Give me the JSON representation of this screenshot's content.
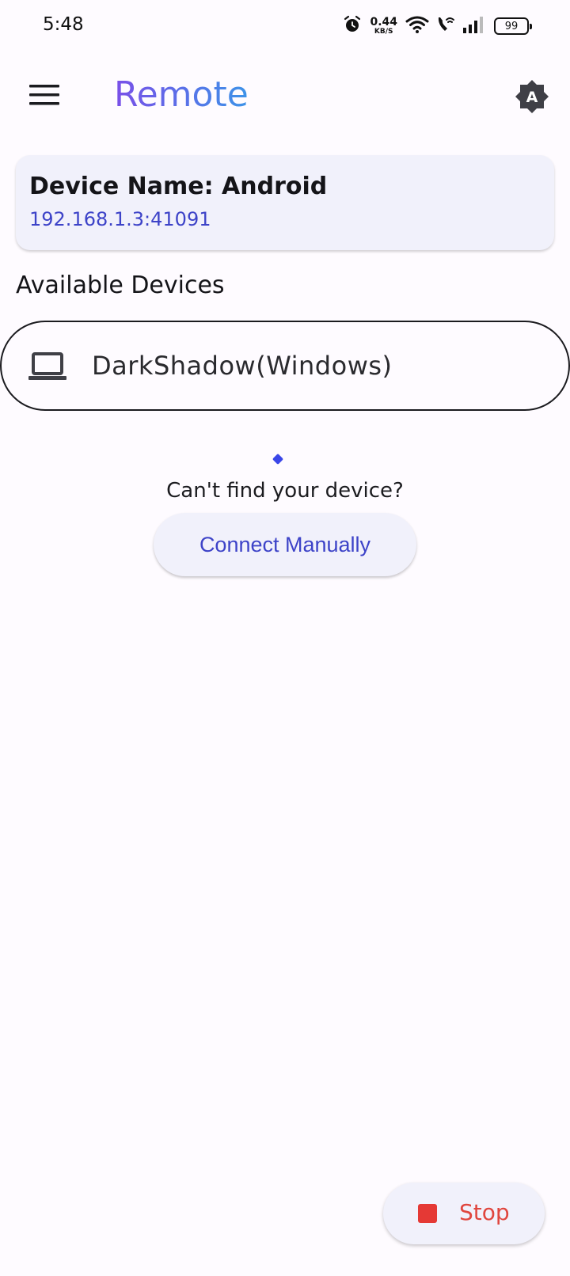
{
  "status_bar": {
    "time": "5:48",
    "net_speed_value": "0.44",
    "net_speed_unit": "KB/S",
    "battery": "99",
    "icons": [
      "alarm-icon",
      "wifi-icon",
      "wifi-calling-icon",
      "signal-icon",
      "battery-icon"
    ]
  },
  "app_bar": {
    "title": "Remote",
    "menu_icon": "menu-icon",
    "theme_badge": "A"
  },
  "device_card": {
    "name": "Device Name: Android",
    "address": "192.168.1.3:41091"
  },
  "available_devices": {
    "title": "Available Devices",
    "items": [
      {
        "label": "DarkShadow(Windows)",
        "icon": "laptop-icon"
      }
    ]
  },
  "discovery": {
    "prompt": "Can't find your device?",
    "connect_label": "Connect Manually"
  },
  "fab": {
    "label": "Stop",
    "icon": "stop-icon"
  },
  "colors": {
    "background": "#FEFBFF",
    "surface": "#F1F1FB",
    "accent": "#3D43C8",
    "title_gradient_start": "#7A4FE8",
    "title_gradient_end": "#3D93E8",
    "stop": "#E53935"
  }
}
